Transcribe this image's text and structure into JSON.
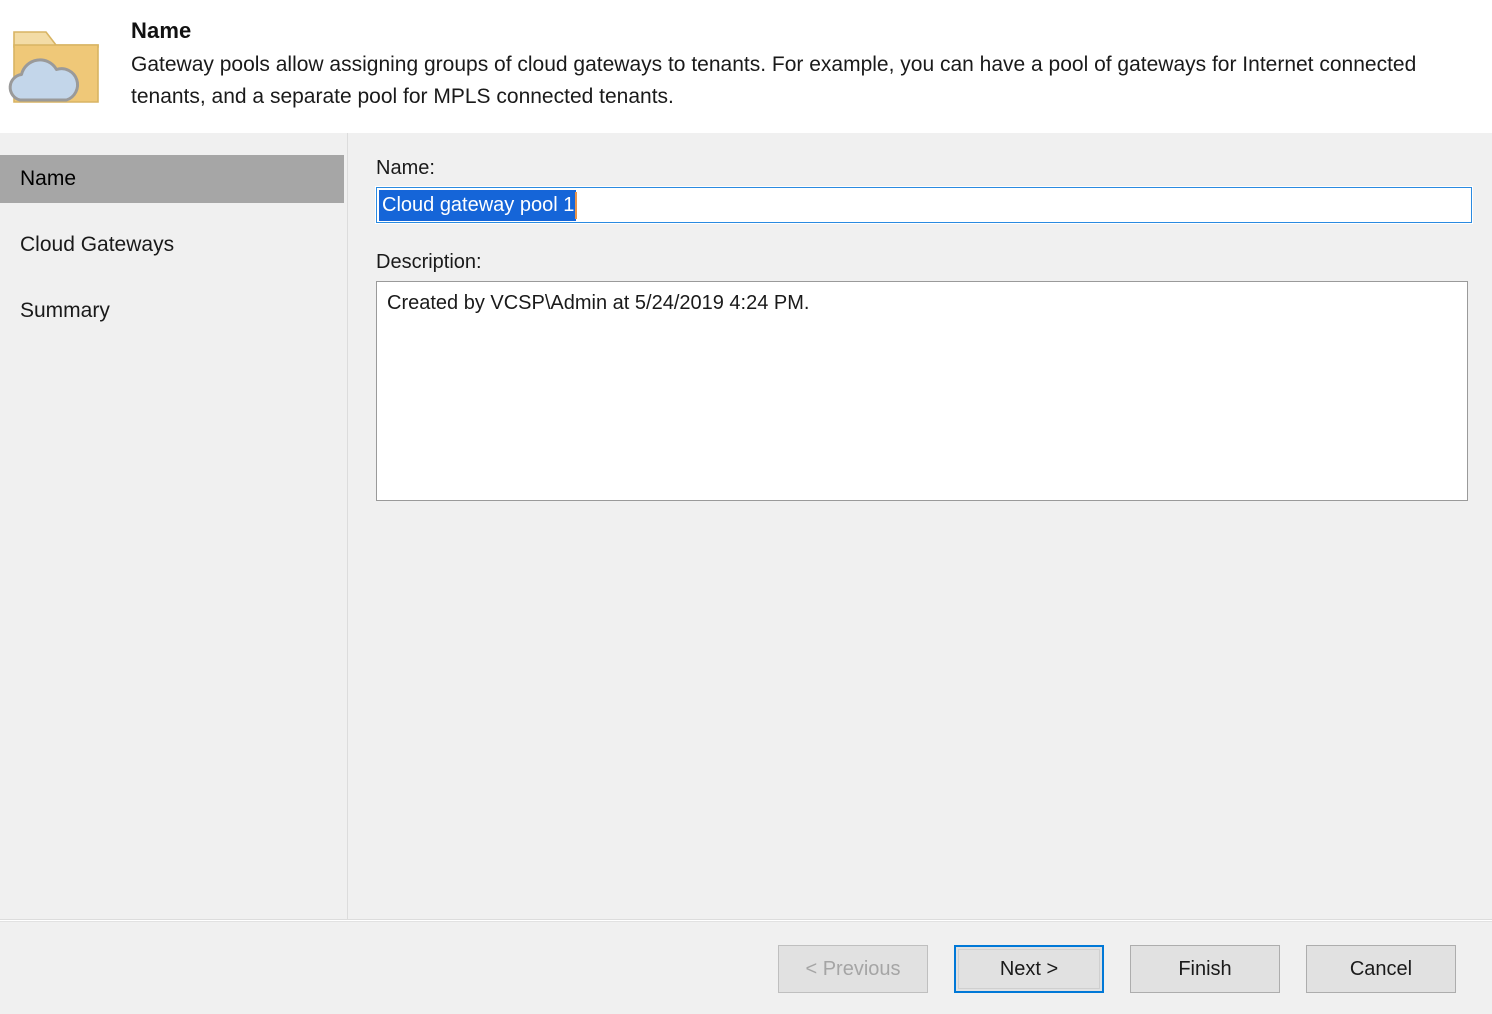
{
  "header": {
    "icon": "folder-cloud-icon",
    "title": "Name",
    "description": "Gateway pools allow assigning groups of cloud gateways to tenants. For example, you can have a pool of gateways for Internet connected tenants, and a separate pool for MPLS connected tenants."
  },
  "sidebar": {
    "items": [
      {
        "label": "Name",
        "selected": true
      },
      {
        "label": "Cloud Gateways",
        "selected": false
      },
      {
        "label": "Summary",
        "selected": false
      }
    ]
  },
  "main": {
    "name_label": "Name:",
    "name_value": "Cloud gateway pool 1",
    "name_selected": true,
    "description_label": "Description:",
    "description_value": "Created by VCSP\\Admin at 5/24/2019 4:24 PM."
  },
  "footer": {
    "buttons": [
      {
        "label": "< Previous",
        "state": "disabled"
      },
      {
        "label": "Next >",
        "state": "default"
      },
      {
        "label": "Finish",
        "state": "normal"
      },
      {
        "label": "Cancel",
        "state": "normal"
      }
    ]
  },
  "colors": {
    "accent": "#0078d7",
    "selection": "#1565d8",
    "sidebar_selected": "#a6a6a6",
    "window_bg": "#f0f0f0",
    "header_bg": "#ffffff",
    "folder": "#edc87a",
    "cloud": "#bcd2e8"
  }
}
